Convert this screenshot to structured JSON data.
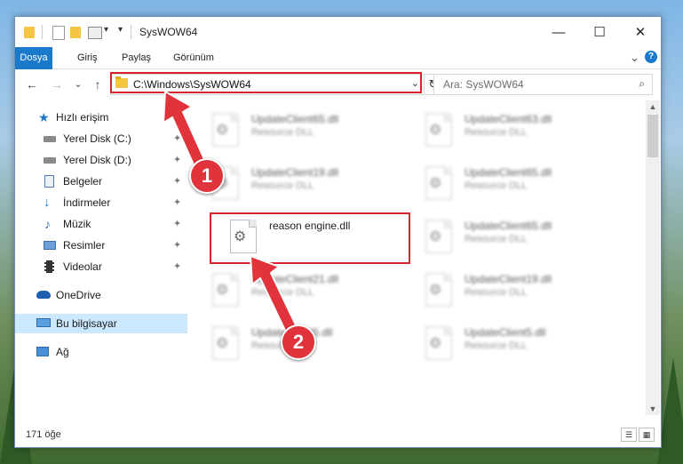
{
  "window": {
    "title": "SysWOW64",
    "minimize_glyph": "—",
    "maximize_glyph": "☐",
    "close_glyph": "✕"
  },
  "ribbon": {
    "tabs": [
      "Dosya",
      "Giriş",
      "Paylaş",
      "Görünüm"
    ],
    "help": "?",
    "expand_glyph": "⌄"
  },
  "nav": {
    "back": "←",
    "forward": "→",
    "recent": "⌄",
    "up": "↑",
    "address": "C:\\Windows\\SysWOW64",
    "address_dropdown": "⌄",
    "refresh": "↻",
    "search_placeholder": "Ara: SysWOW64",
    "search_glyph": "⌕"
  },
  "sidebar": {
    "items": [
      {
        "label": "Hızlı erişim",
        "icon": "star-icon",
        "pinned": false
      },
      {
        "label": "Yerel Disk (C:)",
        "icon": "drive-icon",
        "pinned": true
      },
      {
        "label": "Yerel Disk (D:)",
        "icon": "drive-icon",
        "pinned": true
      },
      {
        "label": "Belgeler",
        "icon": "documents-icon",
        "pinned": true
      },
      {
        "label": "İndirmeler",
        "icon": "downloads-icon",
        "pinned": true
      },
      {
        "label": "Müzik",
        "icon": "music-icon",
        "pinned": true
      },
      {
        "label": "Resimler",
        "icon": "pictures-icon",
        "pinned": true
      },
      {
        "label": "Videolar",
        "icon": "videos-icon",
        "pinned": true
      },
      {
        "label": "OneDrive",
        "icon": "cloud-icon",
        "pinned": false
      },
      {
        "label": "Bu bilgisayar",
        "icon": "computer-icon",
        "pinned": false
      },
      {
        "label": "Ağ",
        "icon": "network-icon",
        "pinned": false
      }
    ],
    "pin_glyph": "📌"
  },
  "files": [
    {
      "name": "UpdateClient65.dll",
      "type": "Resource DLL"
    },
    {
      "name": "UpdateClient63.dll",
      "type": "Resource DLL"
    },
    {
      "name": "UpdateClient19.dll",
      "type": "Resource DLL"
    },
    {
      "name": "UpdateClient65.dll",
      "type": "Resource DLL"
    },
    {
      "name": "reason engine.dll",
      "type": ""
    },
    {
      "name": "UpdateClient65.dll",
      "type": "Resource DLL"
    },
    {
      "name": "UpdateClient21.dll",
      "type": "Resource DLL"
    },
    {
      "name": "UpdateClient19.dll",
      "type": "Resource DLL"
    },
    {
      "name": "UpdateClient5.dll",
      "type": "Resource DLL"
    },
    {
      "name": "UpdateClient5.dll",
      "type": "Resource DLL"
    }
  ],
  "status": {
    "count": "171 öğe"
  },
  "annotations": {
    "step1": "1",
    "step2": "2"
  },
  "colors": {
    "accent": "#1979ca",
    "highlight": "#d9232c",
    "selected": "#cce8ff"
  }
}
